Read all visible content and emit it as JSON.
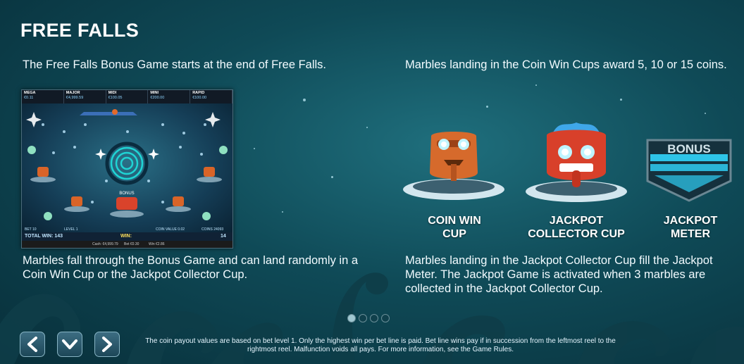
{
  "page": {
    "title": "FREE FALLS",
    "intro_left": "The Free Falls Bonus Game starts at the end of Free Falls.",
    "intro_right": "Marbles landing in the Coin Win Cups award 5, 10 or 15 coins.",
    "desc_left": "Marbles fall through the Bonus Game and can land randomly in a Coin Win Cup or the Jackpot Collector Cup.",
    "desc_right": "Marbles landing in the Jackpot Collector Cup fill the Jackpot Meter. The Jackpot Game is activated when 3 marbles are collected in the Jackpot Collector Cup.",
    "footer": "The coin payout values are based on bet level 1. Only the highest win per bet line is paid. Bet line wins pay if in succession from the leftmost reel to the rightmost reel. Malfunction voids all pays. For more information, see the Game Rules."
  },
  "items": {
    "coin_cup": "COIN WIN CUP",
    "jackpot_cup": "JACKPOT COLLECTOR CUP",
    "meter": "JACKPOT METER",
    "meter_text": "BONUS"
  },
  "screenshot": {
    "jackpots": [
      {
        "name": "MEGA",
        "value": "€0.11"
      },
      {
        "name": "MAJOR",
        "value": "€4,999.59"
      },
      {
        "name": "MIDI",
        "value": "€100.05"
      },
      {
        "name": "MINI",
        "value": "€200.00"
      },
      {
        "name": "RAPID",
        "value": "€100.00"
      }
    ],
    "bet": "BET 10",
    "level": "LEVEL 1",
    "coin_value": "COIN VALUE 0.02",
    "coins": "COINS 24093",
    "total_win": "TOTAL WIN: 143",
    "win": "WIN:",
    "cash": "Cash: €4,999.79",
    "bet_amount": "Bet €0.30",
    "win_amount": "Win €2.86",
    "counter": "14",
    "bonus": "BONUS"
  },
  "pagination": {
    "count": 4,
    "active": 0
  },
  "icons": {
    "prev": "chevron-left-icon",
    "down": "chevron-down-icon",
    "next": "chevron-right-icon"
  }
}
